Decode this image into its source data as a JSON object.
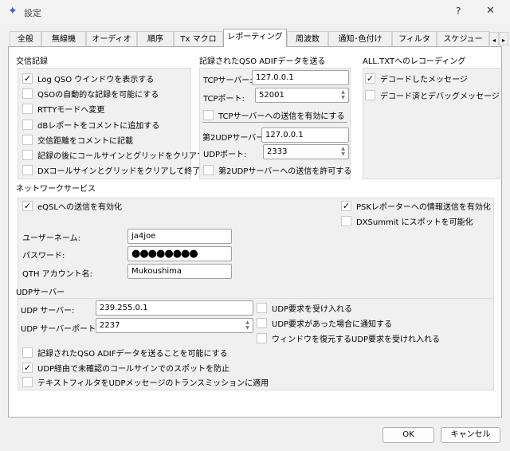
{
  "window": {
    "title": "設定",
    "help": "?",
    "minimize": "—",
    "close": "✕",
    "app_icon": "sparkle-icon"
  },
  "tabs": [
    "全般",
    "無線機",
    "オーディオ",
    "順序",
    "Tx マクロ",
    "レポーティング",
    "周波数",
    "通知･色付け",
    "フィルタ",
    "スケジュー"
  ],
  "tab_scroll": {
    "left": "◂",
    "right": "▸"
  },
  "log": {
    "title": "交信記録",
    "items": [
      {
        "label": "Log QSO ウインドウを表示する",
        "checked": true
      },
      {
        "label": "QSOの自動的な記録を可能にする",
        "checked": false
      },
      {
        "label": "RTTYモードへ変更",
        "checked": false
      },
      {
        "label": "dBレポートをコメントに追加する",
        "checked": false
      },
      {
        "label": "交信距離をコメントに記載",
        "checked": false
      },
      {
        "label": "記録の後にコールサインとグリッドをクリアする",
        "checked": false
      },
      {
        "label": "DXコールサインとグリッドをクリアして終了",
        "checked": false
      }
    ]
  },
  "adif": {
    "title": "記録されたQSO ADIFデータを送る",
    "tcp_server_label": "TCPサーバー:",
    "tcp_server": "127.0.0.1",
    "tcp_port_label": "TCPポート:",
    "tcp_port": "52001",
    "tcp_enable": "TCPサーバーへの送信を有効にする",
    "udp2_server_label": "第2UDPサーバー",
    "udp2_server": "127.0.0.1",
    "udp_port_label": "UDPポート:",
    "udp_port": "2333",
    "udp2_enable": "第2UDPサーバーへの送信を許可する"
  },
  "alltxt": {
    "title": "ALL.TXTへのレコーディング",
    "items": [
      {
        "label": "デコードしたメッセージ",
        "checked": true
      },
      {
        "label": "デコード済とデバッグメッセージ",
        "checked": false
      }
    ]
  },
  "network": {
    "title": "ネットワークサービス",
    "eqsl": "eQSLへの送信を有効化",
    "psk": "PSKレポーターへの情報送信を有効化",
    "dxsummit": "DXSummit にスポットを可能化",
    "username_label": "ユーザーネーム:",
    "username": "ja4joe",
    "password_label": "パスワード:",
    "password": "●●●●●●●●",
    "qth_label": "QTH アカウント名:",
    "qth": "Mukoushima"
  },
  "udp": {
    "title": "UDPサーバー",
    "server_label": "UDP サーバー:",
    "server": "239.255.0.1",
    "port_label": "UDP サーバーポート:",
    "port": "2237",
    "accept": "UDP要求を受け入れる",
    "notify": "UDP要求があった場合に通知する",
    "restore": "ウィンドウを復元するUDP要求を受けれ入れる",
    "adif_enable": "記録されたQSO ADIFデータを送ることを可能にする",
    "prevent": "UDP経由で未確認のコールサインでのスポットを防止",
    "filter": "テキストフィルタをUDPメッセージのトランスミッションに適用"
  },
  "buttons": {
    "ok": "OK",
    "cancel": "キャンセル"
  }
}
